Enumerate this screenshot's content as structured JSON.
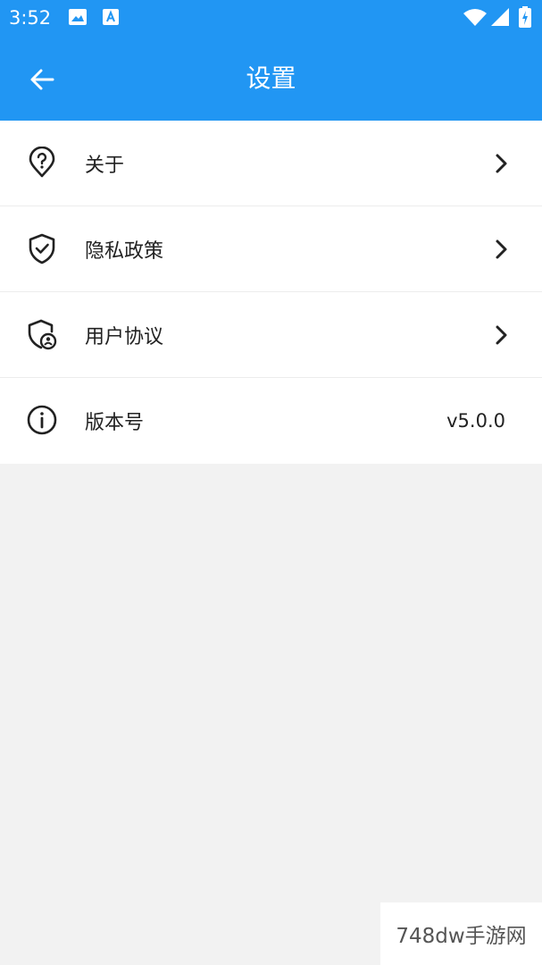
{
  "status_bar": {
    "time": "3:52",
    "icons": [
      "image-icon",
      "app-icon",
      "wifi-icon",
      "signal-icon",
      "battery-icon"
    ]
  },
  "header": {
    "title": "设置",
    "back_icon": "arrow-left-icon",
    "background": "#2196f3"
  },
  "settings": {
    "items": [
      {
        "label": "关于",
        "icon": "help-location-icon",
        "trailing": "chevron-right-icon"
      },
      {
        "label": "隐私政策",
        "icon": "shield-check-icon",
        "trailing": "chevron-right-icon"
      },
      {
        "label": "用户协议",
        "icon": "shield-user-icon",
        "trailing": "chevron-right-icon"
      },
      {
        "label": "版本号",
        "icon": "info-icon",
        "value": "v5.0.0"
      }
    ]
  },
  "watermark": "748dw手游网"
}
